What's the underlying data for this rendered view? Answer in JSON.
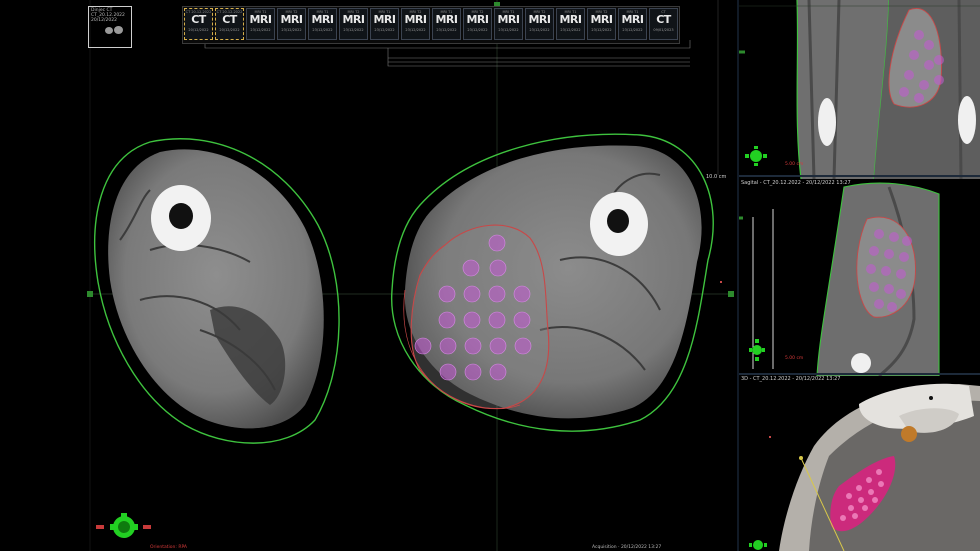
{
  "axial": {
    "patient_box": {
      "line1": "Dinjec CT",
      "line2": "CT_20.12.2022",
      "line3": "20/12/2022"
    },
    "scale_label": "10.0 cm",
    "bottom_left_label": "Orientation: RPA",
    "bottom_right_label": "Acquisition · 20/12/2022 13:27"
  },
  "series_strip": {
    "items": [
      {
        "modality": "CT",
        "top": "CT 20.12.2022",
        "date": "20/12/2022",
        "active": true
      },
      {
        "modality": "CT",
        "top": "CT 20.12.2022",
        "date": "20/12/2022",
        "active": true
      },
      {
        "modality": "MRI",
        "top": "MRI T1",
        "date": "23/12/2022",
        "active": false
      },
      {
        "modality": "MRI",
        "top": "MRI T2",
        "date": "23/12/2022",
        "active": false
      },
      {
        "modality": "MRI",
        "top": "MRI T1",
        "date": "23/12/2022",
        "active": false
      },
      {
        "modality": "MRI",
        "top": "MRI T2",
        "date": "23/12/2022",
        "active": false
      },
      {
        "modality": "MRI",
        "top": "MRI T1",
        "date": "23/12/2022",
        "active": false
      },
      {
        "modality": "MRI",
        "top": "MRI T2",
        "date": "23/12/2022",
        "active": false
      },
      {
        "modality": "MRI",
        "top": "MRI T1",
        "date": "23/12/2022",
        "active": false
      },
      {
        "modality": "MRI",
        "top": "MRI T2",
        "date": "23/12/2022",
        "active": false
      },
      {
        "modality": "MRI",
        "top": "MRI T1",
        "date": "23/12/2022",
        "active": false
      },
      {
        "modality": "MRI",
        "top": "MRI T2",
        "date": "23/12/2022",
        "active": false
      },
      {
        "modality": "MRI",
        "top": "MRI T1",
        "date": "23/12/2022",
        "active": false
      },
      {
        "modality": "MRI",
        "top": "MRI T2",
        "date": "23/12/2022",
        "active": false
      },
      {
        "modality": "MRI",
        "top": "MRI T1",
        "date": "23/12/2022",
        "active": false
      },
      {
        "modality": "CT",
        "top": "CT",
        "date": "09/01/2023",
        "active": false
      }
    ]
  },
  "coronal": {
    "distance_label": "5.00 cm"
  },
  "sagittal": {
    "title": "Sagital - CT_20.12.2022 - 20/12/2022 13:27",
    "distance_label": "5.00 cm"
  },
  "view3d": {
    "title": "3D - CT_20.12.2022 - 20/12/2022 13:27"
  },
  "colors": {
    "body_contour": "#3ec23e",
    "tumor_contour": "#c84848",
    "target_spots": "#c45ad6",
    "orientation": "#22d022"
  }
}
